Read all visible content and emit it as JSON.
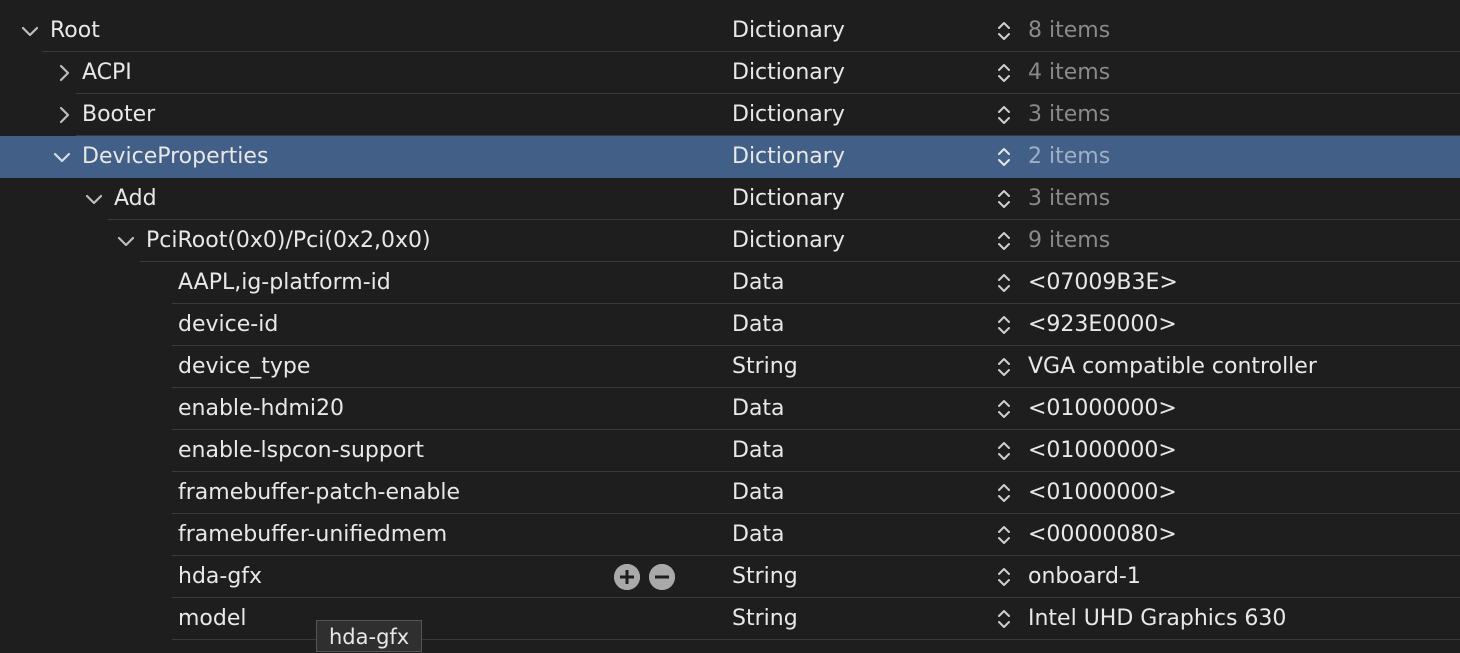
{
  "rows": [
    {
      "key": "Root",
      "type": "Dictionary",
      "value": "8 items"
    },
    {
      "key": "ACPI",
      "type": "Dictionary",
      "value": "4 items"
    },
    {
      "key": "Booter",
      "type": "Dictionary",
      "value": "3 items"
    },
    {
      "key": "DeviceProperties",
      "type": "Dictionary",
      "value": "2 items"
    },
    {
      "key": "Add",
      "type": "Dictionary",
      "value": "3 items"
    },
    {
      "key": "PciRoot(0x0)/Pci(0x2,0x0)",
      "type": "Dictionary",
      "value": "9 items"
    },
    {
      "key": "AAPL,ig-platform-id",
      "type": "Data",
      "value": "<07009B3E>"
    },
    {
      "key": "device-id",
      "type": "Data",
      "value": "<923E0000>"
    },
    {
      "key": "device_type",
      "type": "String",
      "value": "VGA compatible controller"
    },
    {
      "key": "enable-hdmi20",
      "type": "Data",
      "value": "<01000000>"
    },
    {
      "key": "enable-lspcon-support",
      "type": "Data",
      "value": "<01000000>"
    },
    {
      "key": "framebuffer-patch-enable",
      "type": "Data",
      "value": "<01000000>"
    },
    {
      "key": "framebuffer-unifiedmem",
      "type": "Data",
      "value": "<00000080>"
    },
    {
      "key": "hda-gfx",
      "type": "String",
      "value": "onboard-1"
    },
    {
      "key": "model",
      "type": "String",
      "value": "Intel UHD Graphics 630"
    }
  ],
  "tooltip": "hda-gfx",
  "colors": {
    "background": "#1e1e1e",
    "selection": "#415f87",
    "text": "#e8e8e8",
    "dim_text": "#8a8a8a"
  }
}
